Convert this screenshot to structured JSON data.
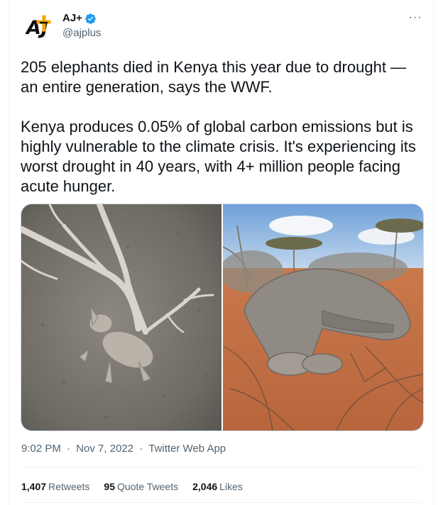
{
  "author": {
    "display_name": "AJ+",
    "handle": "@ajplus",
    "avatar_icon": "ajplus-logo-icon",
    "verified_icon": "verified-badge-icon",
    "verified_color": "#1d9bf0"
  },
  "menu": {
    "more_icon": "more-options-icon",
    "more_label": "···"
  },
  "tweet": {
    "paragraph_1": "205 elephants died in Kenya this year due to drought — an entire generation, says the WWF.",
    "paragraph_2": "Kenya produces 0.05% of global carbon emissions but is highly vulnerable to the climate crisis. It's experiencing its worst drought in 40 years, with 4+ million people facing acute hunger."
  },
  "media": {
    "photo_1_subject": "aerial view of dead elephant beside dry branch",
    "photo_2_subject": "dead elephant lying in red dry bush"
  },
  "meta": {
    "time": "9:02 PM",
    "separator": "·",
    "date": "Nov 7, 2022",
    "source": "Twitter Web App"
  },
  "stats": {
    "retweets_count": "1,407",
    "retweets_label": "Retweets",
    "quotes_count": "95",
    "quotes_label": "Quote Tweets",
    "likes_count": "2,046",
    "likes_label": "Likes"
  }
}
